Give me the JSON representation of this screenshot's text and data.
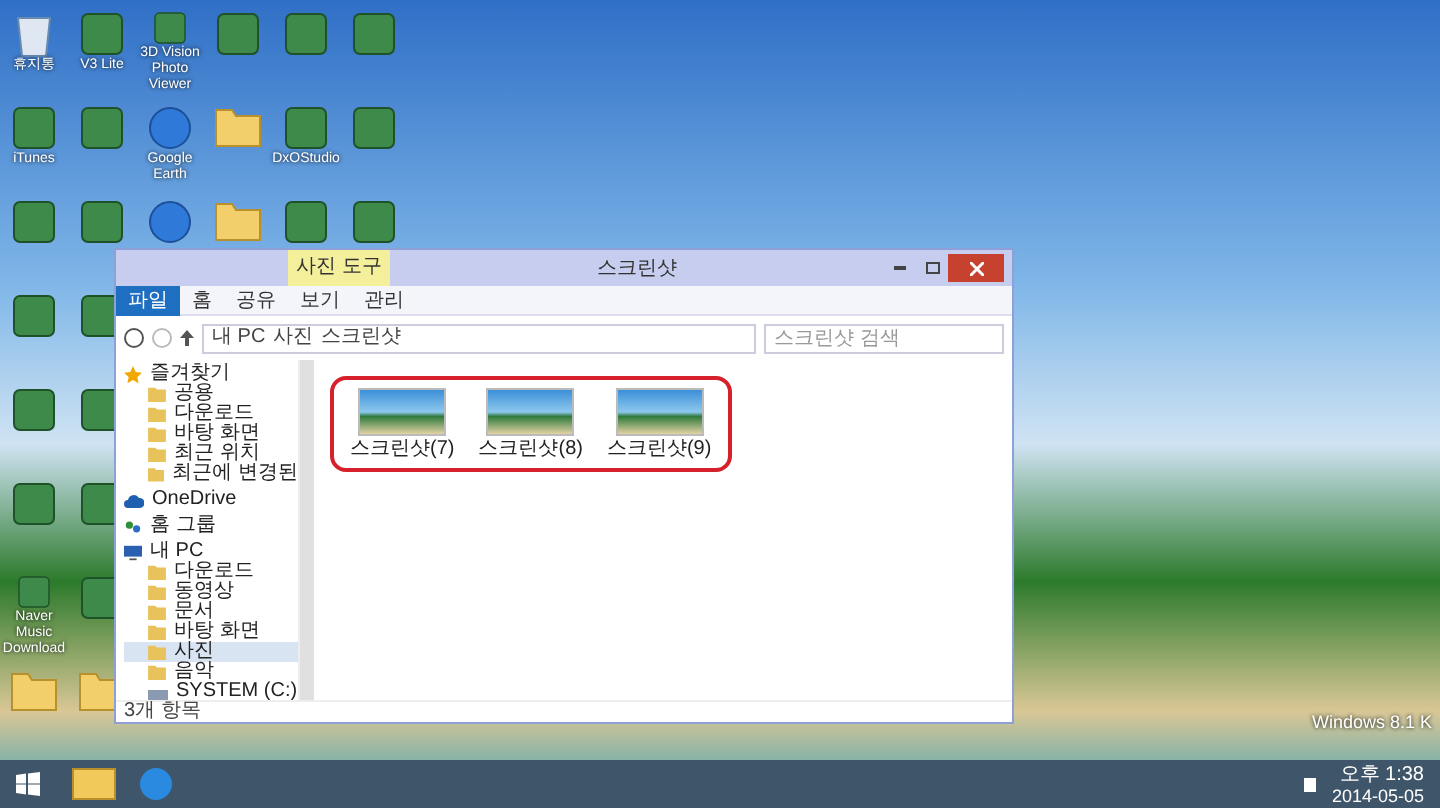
{
  "desktop": {
    "columns": [
      {
        "icons": [
          {
            "kind": "bin",
            "label": "휴지통"
          },
          {
            "kind": "app",
            "label": "iTunes"
          },
          {
            "kind": "app"
          },
          {
            "kind": "app"
          },
          {
            "kind": "app"
          },
          {
            "kind": "app"
          },
          {
            "kind": "app",
            "label": "Naver Music Download"
          },
          {
            "kind": "folder"
          }
        ]
      },
      {
        "icons": [
          {
            "kind": "app",
            "label": "V3 Lite"
          },
          {
            "kind": "app"
          },
          {
            "kind": "app"
          },
          {
            "kind": "app"
          },
          {
            "kind": "app"
          },
          {
            "kind": "app"
          },
          {
            "kind": "app"
          },
          {
            "kind": "folder"
          }
        ]
      },
      {
        "icons": [
          {
            "kind": "app",
            "label": "3D Vision Photo Viewer"
          },
          {
            "kind": "globe",
            "label": "Google Earth"
          },
          {
            "kind": "globe"
          }
        ]
      },
      {
        "icons": [
          {
            "kind": "app"
          },
          {
            "kind": "folder"
          },
          {
            "kind": "folder"
          }
        ]
      },
      {
        "icons": [
          {
            "kind": "app"
          },
          {
            "kind": "app",
            "label": "DxOStudio"
          },
          {
            "kind": "app"
          }
        ]
      },
      {
        "icons": [
          {
            "kind": "app"
          },
          {
            "kind": "app"
          },
          {
            "kind": "app"
          }
        ]
      }
    ]
  },
  "window": {
    "title": "스크린샷",
    "context_tab": "사진 도구",
    "tabs": [
      {
        "label": "파일",
        "selected": true
      },
      {
        "label": "홈",
        "selected": false
      },
      {
        "label": "공유",
        "selected": false
      },
      {
        "label": "보기",
        "selected": false
      },
      {
        "label": "관리",
        "selected": false
      }
    ],
    "breadcrumb": [
      "내 PC",
      "사진",
      "스크린샷"
    ],
    "search": {
      "placeholder": "스크린샷 검색"
    },
    "nav": [
      {
        "label": "즐겨찾기",
        "kind": "star",
        "children": [
          {
            "label": "공용",
            "kind": "folder",
            "selected": false
          },
          {
            "label": "다운로드",
            "kind": "folder",
            "selected": false
          },
          {
            "label": "바탕 화면",
            "kind": "folder",
            "selected": false
          },
          {
            "label": "최근 위치",
            "kind": "folder",
            "selected": false
          },
          {
            "label": "최근에 변경된",
            "kind": "folder",
            "selected": false
          }
        ]
      },
      {
        "label": "OneDrive",
        "kind": "cloud"
      },
      {
        "label": "홈 그룹",
        "kind": "group"
      },
      {
        "label": "내 PC",
        "kind": "pc",
        "children": [
          {
            "label": "다운로드",
            "kind": "folder",
            "selected": false
          },
          {
            "label": "동영상",
            "kind": "folder",
            "selected": false
          },
          {
            "label": "문서",
            "kind": "folder",
            "selected": false
          },
          {
            "label": "바탕 화면",
            "kind": "folder",
            "selected": false
          },
          {
            "label": "사진",
            "kind": "folder",
            "selected": true
          },
          {
            "label": "음악",
            "kind": "folder",
            "selected": false
          },
          {
            "label": "SYSTEM (C:)",
            "kind": "drive",
            "selected": false
          }
        ]
      }
    ],
    "files": [
      {
        "name": "스크린샷(7)"
      },
      {
        "name": "스크린샷(8)"
      },
      {
        "name": "스크린샷(9)"
      }
    ],
    "status": "3개 항목"
  },
  "os_watermark": "Windows 8.1 K",
  "clock": {
    "time": "오후 1:38",
    "date": "2014-05-05"
  }
}
